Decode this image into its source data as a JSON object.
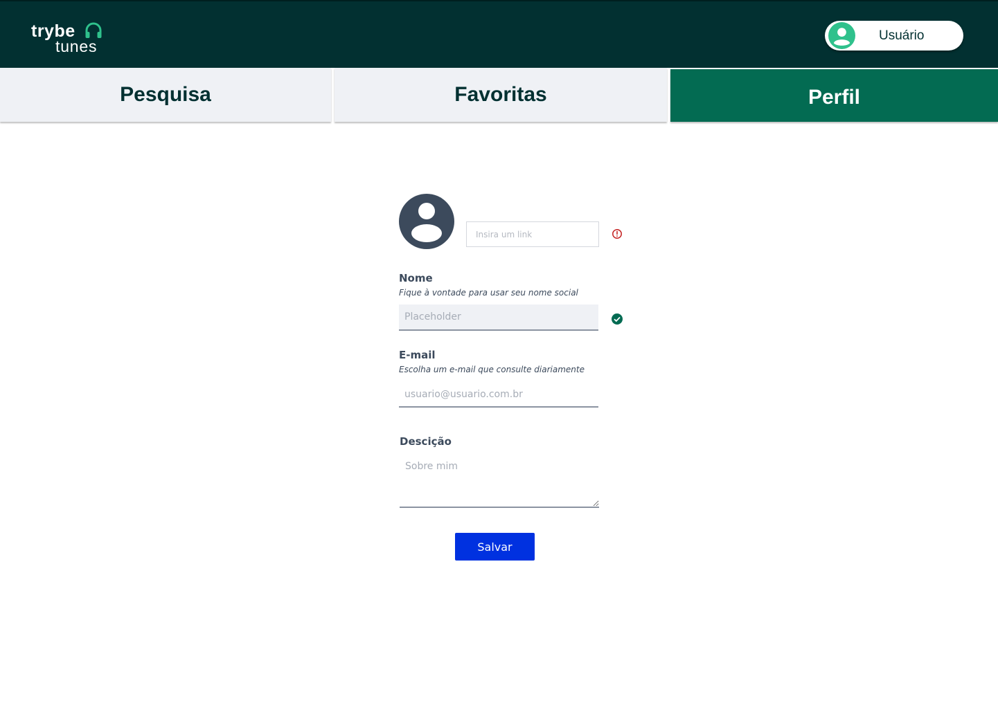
{
  "header": {
    "logo": {
      "word1": "trybe",
      "word2": "tunes"
    },
    "user": {
      "name": "Usuário",
      "icon": "user-avatar-icon"
    }
  },
  "tabs": [
    {
      "label": "Pesquisa",
      "active": false
    },
    {
      "label": "Favoritas",
      "active": false
    },
    {
      "label": "Perfil",
      "active": true
    }
  ],
  "form": {
    "avatar_icon": "user-circle-icon",
    "image_link": {
      "placeholder": "Insira um link",
      "value": "",
      "status_icon": "error-icon"
    },
    "name": {
      "label": "Nome",
      "hint": "Fique à vontade para usar seu nome social",
      "placeholder": "Placeholder",
      "value": "",
      "status_icon": "check-icon"
    },
    "email": {
      "label": "E-mail",
      "hint": "Escolha um e-mail que consulte diariamente",
      "placeholder": "usuario@usuario.com.br",
      "value": ""
    },
    "description": {
      "label": "Descição",
      "placeholder": "Sobre mim",
      "value": ""
    },
    "save_label": "Salvar"
  },
  "colors": {
    "header_bg": "#023031",
    "brand_green": "#036b52",
    "accent_green": "#2fc18c",
    "tab_bg": "#eff1f5",
    "text_dark": "#3c4a5c",
    "error_red": "#c62828",
    "button_blue": "#0031e0"
  }
}
